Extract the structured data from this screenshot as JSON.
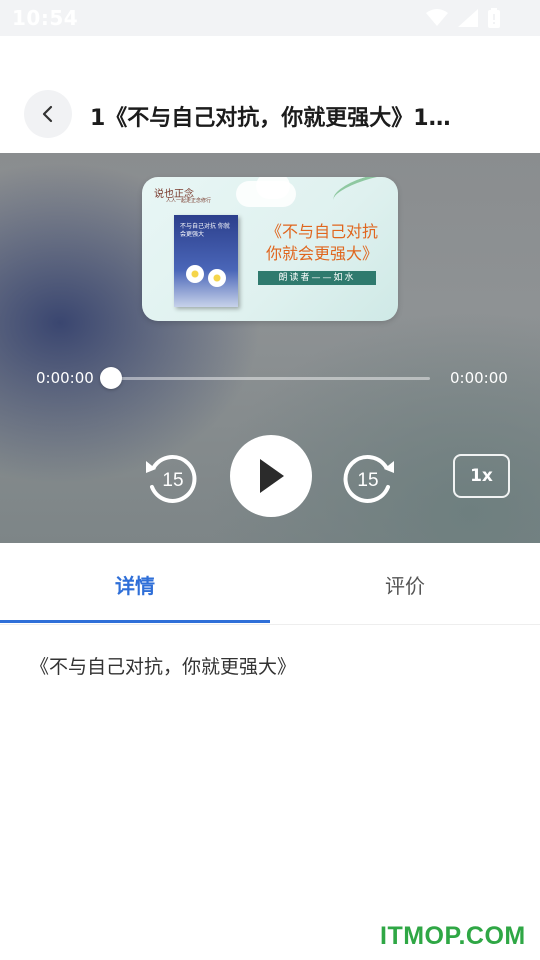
{
  "status_bar": {
    "time": "10:54"
  },
  "header": {
    "title": "1《不与自己对抗，你就更强大》1…"
  },
  "cover": {
    "brand": "说也正念",
    "brand_sub": "人人一起走正念修行",
    "book_title": "不与自己对抗 你就会更强大",
    "title_line1": "《不与自己对抗",
    "title_line2": "你就会更强大》",
    "reader": "朗读者——如水"
  },
  "player": {
    "current_time": "0:00:00",
    "total_time": "0:00:00",
    "progress": 0,
    "rewind_seconds": "15",
    "forward_seconds": "15",
    "speed": "1x"
  },
  "tabs": [
    {
      "label": "详情",
      "active": true
    },
    {
      "label": "评价",
      "active": false
    }
  ],
  "details": {
    "text": "《不与自己对抗，你就更强大》"
  },
  "watermark": "ITMOP.COM",
  "colors": {
    "accent": "#2f6fd8",
    "watermark": "#2fa745",
    "cover_title": "#e0661e"
  }
}
